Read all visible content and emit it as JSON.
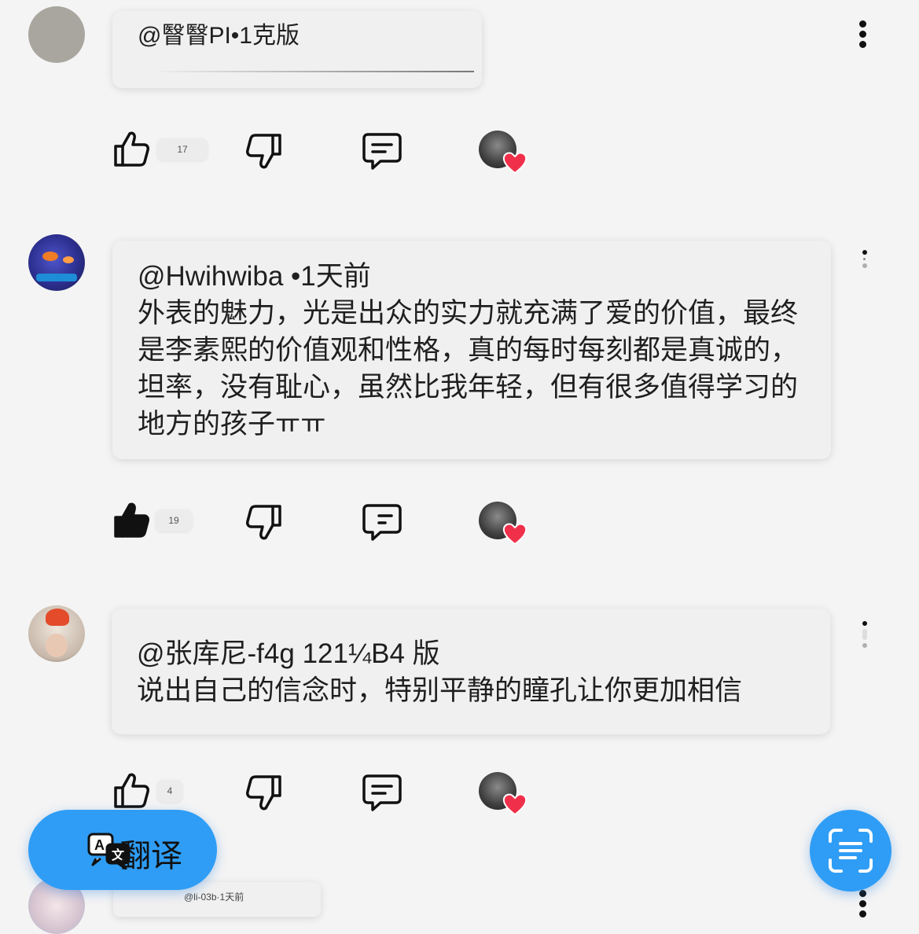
{
  "comments": [
    {
      "author": "@瞖瞖PI•1克版",
      "body": "",
      "likes": "17",
      "liked": false
    },
    {
      "author": "@Hwihwiba •1天前",
      "body": "外表的魅力，光是出众的实力就充满了爱的价值，最终是李素熙的价值观和性格，真的每时每刻都是真诚的，坦率，没有耻心，虽然比我年轻，但有很多值得学习的地方的孩子ㅠㅠ",
      "likes": "19",
      "liked": true
    },
    {
      "author": "@张库尼-f4g 121¼B4 版",
      "body": "说出自己的信念时，特别平静的瞳孔让你更加相信",
      "likes": "4",
      "liked": false
    },
    {
      "author": "@li-03b·1天前",
      "body": ""
    }
  ],
  "translate_button": {
    "label": "翻译"
  },
  "colors": {
    "accent": "#2f9df5",
    "heart": "#f0304a"
  },
  "icons": [
    "thumbs-up-icon",
    "thumbs-down-icon",
    "reply-icon",
    "heart-icon",
    "translate-icon",
    "scan-text-icon",
    "more-vert-icon"
  ]
}
